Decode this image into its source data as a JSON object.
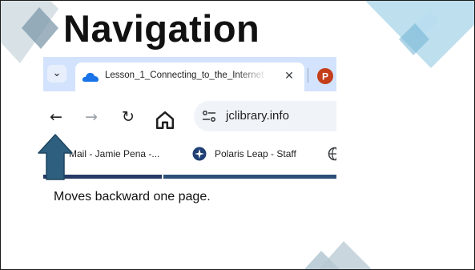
{
  "slide": {
    "title": "Navigation",
    "caption": "Moves backward one page."
  },
  "browser": {
    "tab_strip": {
      "dropdown_icon": "chevron-down-icon",
      "active_tab": {
        "icon": "onedrive-cloud-icon",
        "title": "Lesson_1_Connecting_to_the_Internet",
        "close_icon": "close-icon"
      },
      "next_tab_icon": "powerpoint-icon"
    },
    "toolbar": {
      "back_icon": "back-arrow-icon",
      "forward_icon": "forward-arrow-icon",
      "reload_icon": "reload-icon",
      "home_icon": "home-icon",
      "site_info_icon": "site-info-icon",
      "url": "jclibrary.info"
    },
    "bookmarks": [
      {
        "label": "Mail - Jamie Pena -...",
        "icon": "outlook-mail-icon"
      },
      {
        "label": "Polaris Leap - Staff",
        "icon": "polaris-icon"
      },
      {
        "label": "",
        "icon": "globe-icon"
      }
    ]
  },
  "colors": {
    "accent_arrow": "#2e5f7e",
    "tabbar_bg": "#d3e3fd",
    "deco_light": "#a8d4e8",
    "deco_grey": "#c8d4dc",
    "ppt_red": "#c43e1c"
  }
}
